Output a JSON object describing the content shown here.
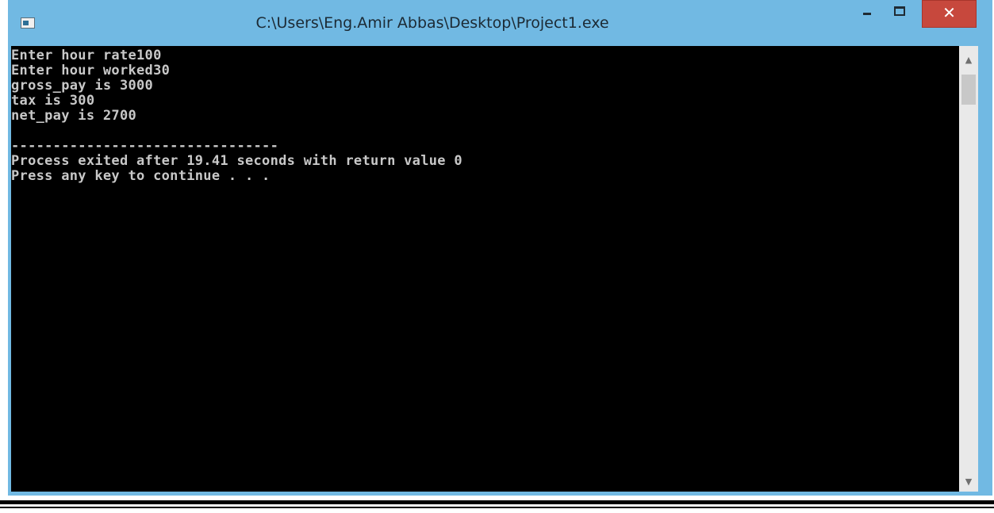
{
  "window": {
    "title": "C:\\Users\\Eng.Amir Abbas\\Desktop\\Project1.exe",
    "app_icon": "console-window-icon",
    "controls": {
      "minimize_icon": "minimize-icon",
      "maximize_icon": "maximize-icon",
      "close_icon": "close-icon",
      "close_glyph": "✕",
      "close_color": "#c7483d"
    },
    "frame_color": "#71b9e3"
  },
  "console": {
    "background": "#000000",
    "text_color": "#c8c8c8",
    "lines": [
      "Enter hour rate100",
      "Enter hour worked30",
      "gross_pay is 3000",
      "tax is 300",
      "net_pay is 2700",
      "",
      "--------------------------------",
      "Process exited after 19.41 seconds with return value 0",
      "Press any key to continue . . ."
    ]
  },
  "scrollbar": {
    "up_glyph": "▲",
    "down_glyph": "▼"
  }
}
